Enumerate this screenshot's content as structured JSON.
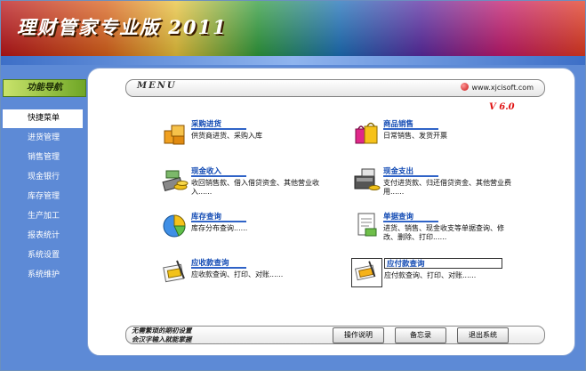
{
  "app": {
    "title": "理财管家专业版 2011",
    "menu_label": "MENU",
    "website": "www.xjcisoft.com",
    "version": "V 6.0"
  },
  "sidebar": {
    "title": "功能导航",
    "items": [
      {
        "label": "快捷菜单",
        "active": true
      },
      {
        "label": "进货管理"
      },
      {
        "label": "销售管理"
      },
      {
        "label": "现金银行"
      },
      {
        "label": "库存管理"
      },
      {
        "label": "生产加工"
      },
      {
        "label": "报表统计"
      },
      {
        "label": "系统设置"
      },
      {
        "label": "系统维护"
      }
    ]
  },
  "modules": [
    {
      "title": "采购进货",
      "desc": "供货商进货、采购入库",
      "icon": "purchase-icon"
    },
    {
      "title": "商品销售",
      "desc": "日常销售、发货开票",
      "icon": "sales-icon"
    },
    {
      "title": "现金收入",
      "desc": "收回销售款、借入借贷资金、其他营业收入......",
      "icon": "cash-income-icon"
    },
    {
      "title": "现金支出",
      "desc": "支付进货款、归还借贷资金、其他营业费用......",
      "icon": "cash-expense-icon"
    },
    {
      "title": "库存查询",
      "desc": "库存分布查询......",
      "icon": "inventory-chart-icon"
    },
    {
      "title": "单据查询",
      "desc": "进货、销售、现金收支等单据查询、修改、删除、打印......",
      "icon": "document-query-icon"
    },
    {
      "title": "应收款查询",
      "desc": "应收款查询、打印、对账......",
      "icon": "receivable-icon"
    },
    {
      "title": "应付款查询",
      "desc": "应付款查询、打印、对账......",
      "icon": "payable-icon"
    }
  ],
  "footer": {
    "tip_line1": "无需繁琐的期初设置",
    "tip_line2": "会汉字输入就能掌握",
    "buttons": [
      "操作说明",
      "备忘录",
      "退出系统"
    ]
  },
  "colors": {
    "accent_blue": "#1049b3",
    "background_blue": "#5d8ad6",
    "version_red": "#e01010"
  }
}
